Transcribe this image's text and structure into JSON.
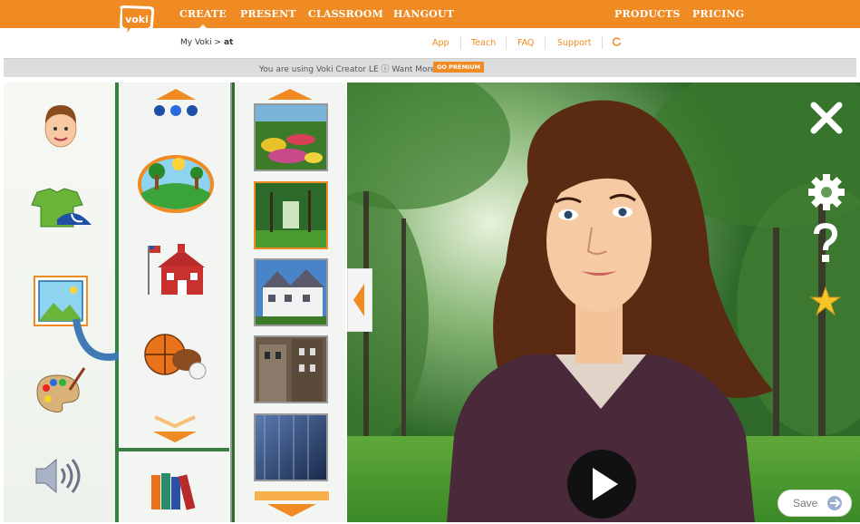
{
  "brand": {
    "logo_text": "voki",
    "accent": "#f08a23",
    "nav_color": "#ffffff"
  },
  "nav": {
    "create": "CREATE",
    "present": "PRESENT",
    "classroom": "CLASSROOM",
    "hangout": "HANGOUT",
    "products": "PRODUCTS",
    "pricing": "PRICING"
  },
  "breadcrumb": {
    "root": "My Voki",
    "sep": ">",
    "current": "at"
  },
  "sublinks": {
    "app": "App",
    "teach": "Teach",
    "faq": "FAQ",
    "support": "Support",
    "refresh_icon": "refresh-icon"
  },
  "infobar": {
    "text": "You are using Voki Creator LE ⓘ Want More?",
    "premium": "GO PREMIUM"
  },
  "categories": [
    {
      "name": "character",
      "icon": "boy-face-icon"
    },
    {
      "name": "clothing",
      "icon": "shirt-cap-icon"
    },
    {
      "name": "background",
      "icon": "picture-icon",
      "selected": true
    },
    {
      "name": "color",
      "icon": "palette-icon"
    },
    {
      "name": "voice",
      "icon": "speaker-icon"
    }
  ],
  "subcategories": [
    {
      "name": "nature",
      "icon": "landscape-icon"
    },
    {
      "name": "school",
      "icon": "schoolhouse-icon"
    },
    {
      "name": "sports",
      "icon": "sports-balls-icon"
    },
    {
      "name": "books",
      "icon": "books-icon"
    }
  ],
  "backgrounds": [
    {
      "name": "flower-garden"
    },
    {
      "name": "park-trees",
      "selected": true
    },
    {
      "name": "white-house"
    },
    {
      "name": "old-buildings"
    },
    {
      "name": "blue-skyscraper"
    }
  ],
  "stage_controls": {
    "close": "close-icon",
    "settings": "gear-icon",
    "help": "question-icon",
    "favorite": "star-icon",
    "play": "play-icon"
  },
  "save": {
    "label": "Save"
  }
}
